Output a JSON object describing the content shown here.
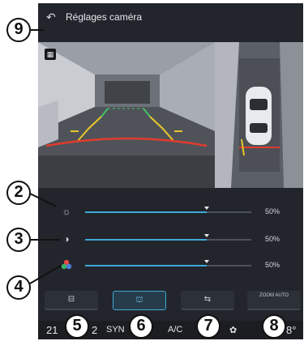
{
  "header": {
    "back_icon": "arrow-left-icon",
    "title": "Réglages caméra"
  },
  "camera": {
    "views": [
      "rear-camera",
      "top-view"
    ],
    "lines": {
      "near": "#e23b2e",
      "mid": "#e8c62a",
      "far": "#48c06a"
    },
    "view_button_icon": "camera-switch-icon"
  },
  "sliders": [
    {
      "icon": "brightness-icon",
      "glyph": "☼",
      "value": 50,
      "label": "50%"
    },
    {
      "icon": "contrast-icon",
      "glyph": "◑",
      "value": 50,
      "label": "50%"
    },
    {
      "icon": "color-icon",
      "glyph": "●",
      "value": 50,
      "label": "50%"
    }
  ],
  "tabs": [
    {
      "icon": "rear-view-icon",
      "glyph": "⊟",
      "active": false
    },
    {
      "icon": "front-view-icon",
      "glyph": "⛫",
      "active": true
    },
    {
      "icon": "side-view-icon",
      "glyph": "⇆",
      "active": false
    },
    {
      "icon": "auto-zoom-icon",
      "text": "ZOOM AUTO",
      "active": false
    }
  ],
  "status_bar": {
    "left_temp": "21",
    "left_temp_suffix": "2",
    "sync_label": "SYN",
    "ac_label": "A/C",
    "right_temp": "8°"
  },
  "callouts": [
    "9",
    "2",
    "3",
    "4",
    "5",
    "6",
    "7",
    "8"
  ],
  "accent": "#3ea9d6"
}
